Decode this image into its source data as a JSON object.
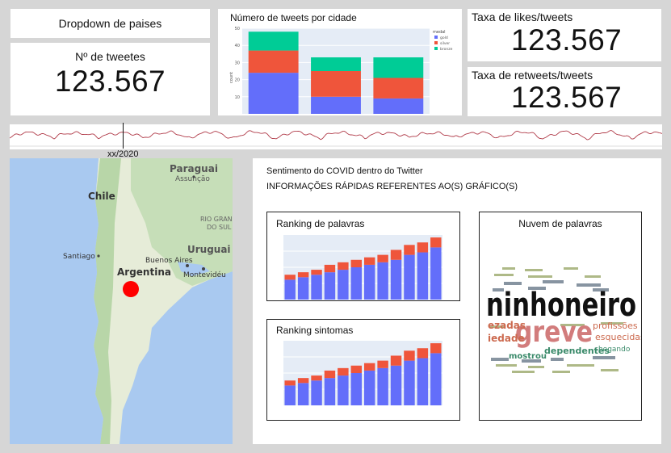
{
  "dropdown": {
    "label": "Dropdown de paises"
  },
  "tweets_count": {
    "label": "Nº de tweetes",
    "value": "123.567"
  },
  "likes_rate": {
    "label": "Taxa de likes/tweets",
    "value": "123.567"
  },
  "retweets_rate": {
    "label": "Taxa de retweets/tweets",
    "value": "123.567"
  },
  "timeline": {
    "marker_label": "xx/2020"
  },
  "map": {
    "labels": {
      "paraguai": "Paraguai",
      "assuncao": "Assunção",
      "chile": "Chile",
      "rio_grande": "RIO GRAND",
      "rio_grande2": "DO SUL",
      "uruguai": "Uruguai",
      "santiago": "Santiago",
      "buenos_aires": "Buenos Aires",
      "argentina": "Argentina",
      "montevideu": "Montevidéu"
    },
    "marker_color": "#ff0000"
  },
  "panel": {
    "title": "Sentimento do COVID dentro do Twitter",
    "subtitle": "INFORMAÇÕES RÁPIDAS REFERENTES AO(S) GRÁFICO(S)"
  },
  "ranking_palavras": {
    "title": "Ranking de palavras"
  },
  "ranking_sintomas": {
    "title": "Ranking sintomas"
  },
  "word_cloud": {
    "title": "Nuvem de palavras",
    "words": {
      "w1": "ninhoneiro",
      "w2": "greve",
      "w3": "profissões",
      "w4": "esquecidas",
      "w5": "dependentes",
      "w6": "mostrou",
      "w7": "ezadas",
      "w8": "iedade",
      "w9": "chegando"
    }
  },
  "chart_data": [
    {
      "type": "bar",
      "title": "Número de tweets por cidade",
      "categories": [
        "",
        "",
        ""
      ],
      "series": [
        {
          "name": "gold",
          "values": [
            24,
            10,
            9
          ],
          "color": "#636efa"
        },
        {
          "name": "silver",
          "values": [
            13,
            15,
            12
          ],
          "color": "#ef553b"
        },
        {
          "name": "bronze",
          "values": [
            11,
            8,
            12
          ],
          "color": "#00cc96"
        }
      ],
      "ylabel": "count",
      "ylim": [
        0,
        50
      ],
      "yticks": [
        10,
        20,
        30,
        40,
        50
      ],
      "legend_title": "medal",
      "legend": "right"
    },
    {
      "type": "bar",
      "title": "Ranking de palavras",
      "categories": [
        "",
        "",
        "",
        "",
        "",
        "",
        "",
        "",
        "",
        "",
        "",
        ""
      ],
      "series": [
        {
          "name": "",
          "values": [
            8,
            9,
            10,
            11,
            12,
            13,
            14,
            15,
            16,
            18,
            19,
            21
          ],
          "color": "#636efa"
        },
        {
          "name": "",
          "values": [
            2,
            2,
            2,
            3,
            3,
            3,
            3,
            3,
            4,
            4,
            4,
            4
          ],
          "color": "#ef553b"
        }
      ],
      "ylim": [
        0,
        26
      ]
    },
    {
      "type": "bar",
      "title": "Ranking sintomas",
      "categories": [
        "",
        "",
        "",
        "",
        "",
        "",
        "",
        "",
        "",
        "",
        "",
        ""
      ],
      "series": [
        {
          "name": "",
          "values": [
            8,
            9,
            10,
            11,
            12,
            13,
            14,
            15,
            16,
            18,
            19,
            21
          ],
          "color": "#636efa"
        },
        {
          "name": "",
          "values": [
            2,
            2,
            2,
            3,
            3,
            3,
            3,
            3,
            4,
            4,
            4,
            4
          ],
          "color": "#ef553b"
        }
      ],
      "ylim": [
        0,
        26
      ]
    }
  ]
}
